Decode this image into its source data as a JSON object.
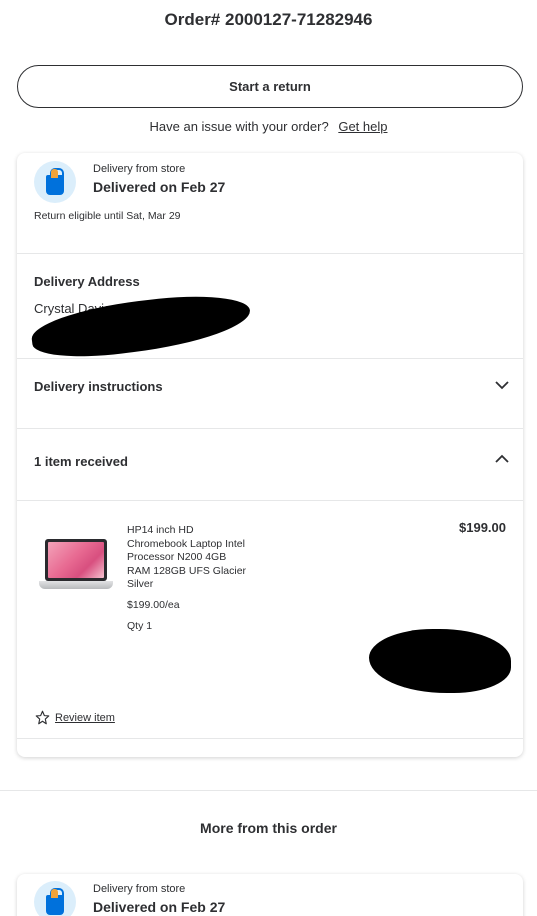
{
  "order": {
    "title": "Order# 2000127-71282946"
  },
  "actions": {
    "start_return": "Start a return"
  },
  "help": {
    "question": "Have an issue with your order?",
    "link": "Get help"
  },
  "delivery": {
    "source": "Delivery from store",
    "status": "Delivered on Feb 27",
    "return_note": "Return eligible until Sat, Mar 29"
  },
  "address": {
    "heading": "Delivery Address",
    "name": "Crystal Davis"
  },
  "instructions": {
    "heading": "Delivery instructions"
  },
  "items": {
    "heading": "1 item received",
    "list": [
      {
        "name": "HP14 inch HD Chromebook Laptop Intel Processor N200 4GB RAM 128GB UFS Glacier Silver",
        "each": "$199.00/ea",
        "qty": "Qty 1",
        "price": "$199.00",
        "review_label": "Review item"
      }
    ]
  },
  "more": {
    "heading": "More from this order",
    "source": "Delivery from store",
    "status": "Delivered on Feb 27"
  },
  "colors": {
    "accent_blue": "#0071dc",
    "icon_bg": "#dbeefb",
    "text": "#2e2f32"
  },
  "icons": [
    "bag-icon",
    "chevron-down-icon",
    "chevron-up-icon",
    "star-icon"
  ]
}
